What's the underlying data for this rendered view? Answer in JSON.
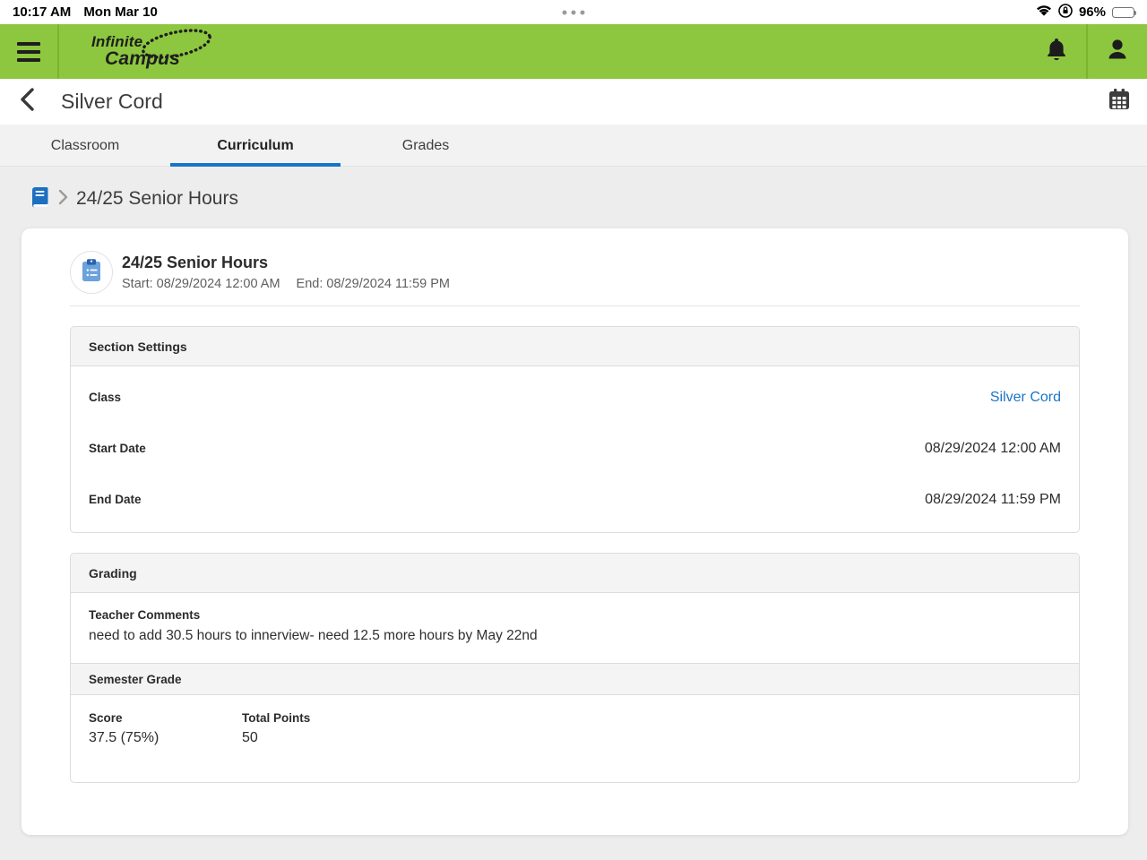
{
  "status_bar": {
    "time": "10:17 AM",
    "date": "Mon Mar 10",
    "battery_percent": "96%"
  },
  "header": {
    "logo_line1": "Infinite",
    "logo_line2": "Campus"
  },
  "nav": {
    "title": "Silver Cord"
  },
  "tabs": [
    {
      "label": "Classroom",
      "active": false
    },
    {
      "label": "Curriculum",
      "active": true
    },
    {
      "label": "Grades",
      "active": false
    }
  ],
  "breadcrumb": {
    "item": "24/25 Senior Hours"
  },
  "assignment": {
    "title": "24/25 Senior Hours",
    "start": "Start: 08/29/2024 12:00 AM",
    "end": "End: 08/29/2024 11:59 PM"
  },
  "section_settings": {
    "title": "Section Settings",
    "rows": [
      {
        "label": "Class",
        "value": "Silver Cord"
      },
      {
        "label": "Start Date",
        "value": "08/29/2024 12:00 AM"
      },
      {
        "label": "End Date",
        "value": "08/29/2024 11:59 PM"
      }
    ]
  },
  "grading": {
    "title": "Grading",
    "teacher_comments_label": "Teacher Comments",
    "teacher_comments": "need to add 30.5 hours to innerview- need 12.5 more hours by May 22nd",
    "semester_grade_label": "Semester Grade",
    "score_label": "Score",
    "score": "37.5 (75%)",
    "total_points_label": "Total Points",
    "total_points": "50"
  },
  "colors": {
    "header_green": "#8dc73f",
    "header_green_dark": "#7db32f",
    "tab_underline_blue": "#1774c8",
    "link_blue": "#1c75c8",
    "panel_header_gray": "#f4f4f4",
    "page_background": "#ededed"
  }
}
